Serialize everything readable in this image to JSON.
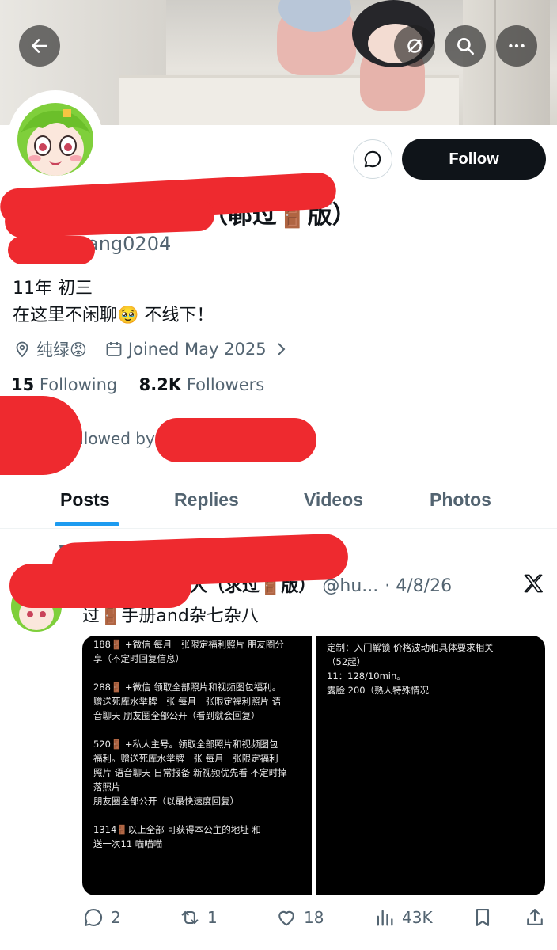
{
  "header": {
    "back_icon": "arrow-left-icon",
    "grok_icon": "slash-circle-icon",
    "search_icon": "search-icon",
    "more_icon": "more-icon"
  },
  "profile": {
    "display_name_visible": "𫑡过🚪版）",
    "display_name_prefix": "（",
    "handle_visible": "ang0204",
    "follow_label": "Follow",
    "bio_line1": "11年 初三",
    "bio_line2": "在这里不闲聊🥹 不线下！",
    "location": "纯绿😡",
    "joined": "Joined May 2025",
    "following_count": "15",
    "following_label": "Following",
    "followers_count": "8.2K",
    "followers_label": "Followers",
    "followed_by": "ollowed by"
  },
  "tabs": [
    {
      "label": "Posts",
      "active": true
    },
    {
      "label": "Replies",
      "active": false
    },
    {
      "label": "Videos",
      "active": false
    },
    {
      "label": "Photos",
      "active": false
    }
  ],
  "post": {
    "pinned_label": "Pi",
    "name_visible": "人（求过🚪版）",
    "handle": "@hu...",
    "date": "· 4/8/26",
    "text": "过🚪手册and杂七杂八",
    "media_left_lines": [
      "188🚪 +微信 每月一张限定福利照片 朋友圈分",
      "享（不定时回复信息）",
      "",
      "288🚪 +微信 领取全部照片和视频图包福利。",
      "赠送死库水举牌一张 每月一张限定福利照片 语",
      "音聊天 朋友圈全部公开（看到就会回复）",
      "",
      "520🚪 +私人主号。领取全部照片和视频图包",
      "福利。赠送死库水举牌一张 每月一张限定福利",
      "照片 语音聊天 日常报备 新视频优先看 不定时掉",
      "落照片",
      "朋友圈全部公开（以最快速度回复）",
      "",
      "1314🚪以上全部 可获得本公主的地址 和",
      "送一次11 喵喵喵"
    ],
    "media_right_lines": [
      "定制：入门解锁 价格波动和具体要求相关",
      "（52起）",
      "11：128/10min。",
      "露脸 200（熟人特殊情况"
    ],
    "replies": "2",
    "reposts": "1",
    "likes": "18",
    "views": "43K"
  },
  "colors": {
    "accent": "#1d9bf0",
    "text": "#0f1419",
    "secondary": "#536471",
    "redaction": "#ee2a2f"
  }
}
